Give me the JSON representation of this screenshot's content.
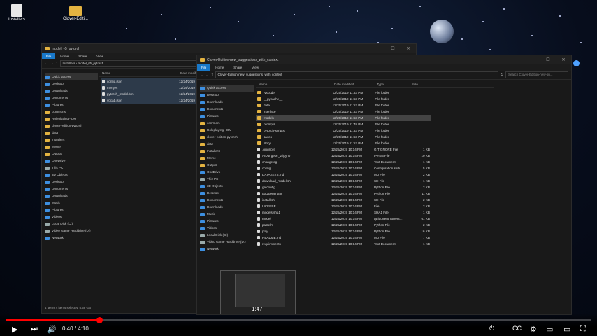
{
  "desktop": {
    "icons": [
      {
        "label": "Installers",
        "icon": "installer-icon"
      },
      {
        "label": "Clover-Editi...",
        "icon": "folder-icon"
      }
    ]
  },
  "back_window": {
    "title": "model_v5_pytorch",
    "ribbon": [
      "File",
      "Home",
      "Share",
      "View"
    ],
    "path": [
      "Installers",
      "model_v5_pytorch"
    ],
    "nav": {
      "quick_access": "Quick access",
      "pinned": [
        "Desktop",
        "Downloads",
        "Documents",
        "Pictures",
        "commons",
        "Roleplaying - DM",
        "clover-edition-pytorch",
        "data",
        "Installers",
        "Meme",
        "Output"
      ],
      "onedrive": "OneDrive",
      "this_pc": "This PC",
      "pc_items": [
        "3D Objects",
        "Desktop",
        "Documents",
        "Downloads",
        "Music",
        "Pictures",
        "Videos",
        "Local Disk (C:)",
        "Video Game Harddrive (D:)"
      ],
      "network": "Network"
    },
    "columns": {
      "name": "Name",
      "date": "Date modifi"
    },
    "files": [
      {
        "name": "config.json",
        "date": "12/24/2019"
      },
      {
        "name": "merges",
        "date": "12/24/2019"
      },
      {
        "name": "pytorch_model.bin",
        "date": "12/24/2019"
      },
      {
        "name": "vocab.json",
        "date": "12/24/2019"
      }
    ],
    "status": "4 items    4 items selected  5.59 GB"
  },
  "front_window": {
    "title": "Clover-Edition-new_suggestions_with_context",
    "ribbon": [
      "File",
      "Home",
      "Share",
      "View"
    ],
    "path": [
      "Clover-Edition-new_suggestions_with_context"
    ],
    "search_placeholder": "Search Clover-Edition-new-su...",
    "nav": {
      "quick_access": "Quick access",
      "pinned": [
        "Desktop",
        "Downloads",
        "Documents",
        "Pictures",
        "common",
        "Roleplaying - DM",
        "clover-edition-pytorch",
        "data",
        "Installers",
        "Meme",
        "Output"
      ],
      "onedrive": "OneDrive",
      "this_pc": "This PC",
      "pc_items": [
        "3D Objects",
        "Desktop",
        "Documents",
        "Downloads",
        "Music",
        "Pictures",
        "Videos",
        "Local Disk (C:)",
        "Video Game Harddrive (D:)"
      ],
      "network": "Network"
    },
    "columns": {
      "name": "Name",
      "date": "Date modified",
      "type": "Type",
      "size": "Size"
    },
    "files": [
      {
        "name": ".vscode",
        "date": "12/25/2019 11:53 PM",
        "type": "File folder",
        "size": "",
        "kind": "folder"
      },
      {
        "name": "__pycache__",
        "date": "12/25/2019 11:53 PM",
        "type": "File folder",
        "size": "",
        "kind": "folder"
      },
      {
        "name": "data",
        "date": "12/25/2019 11:53 PM",
        "type": "File folder",
        "size": "",
        "kind": "folder"
      },
      {
        "name": "interface",
        "date": "12/25/2019 11:53 PM",
        "type": "File folder",
        "size": "",
        "kind": "folder"
      },
      {
        "name": "models",
        "date": "12/25/2019 11:53 PM",
        "type": "File folder",
        "size": "",
        "kind": "folder"
      },
      {
        "name": "prompts",
        "date": "12/25/2019 11:48 PM",
        "type": "File folder",
        "size": "",
        "kind": "folder"
      },
      {
        "name": "pytorch-scripts",
        "date": "12/25/2019 11:53 PM",
        "type": "File folder",
        "size": "",
        "kind": "folder"
      },
      {
        "name": "saves",
        "date": "12/25/2019 11:53 PM",
        "type": "File folder",
        "size": "",
        "kind": "folder"
      },
      {
        "name": "story",
        "date": "12/25/2019 11:53 PM",
        "type": "File folder",
        "size": "",
        "kind": "folder"
      },
      {
        "name": ".gitignore",
        "date": "12/25/2019 10:14 PM",
        "type": "GITIGNORE File",
        "size": "1 KB",
        "kind": "file"
      },
      {
        "name": "AIDungeon_2.ipynb",
        "date": "12/25/2019 10:14 PM",
        "type": "IPYNB File",
        "size": "10 KB",
        "kind": "file"
      },
      {
        "name": "changelog",
        "date": "12/25/2019 10:14 PM",
        "type": "Text Document",
        "size": "1 KB",
        "kind": "file"
      },
      {
        "name": "config",
        "date": "12/25/2019 10:14 PM",
        "type": "Configuration setti...",
        "size": "5 KB",
        "kind": "file"
      },
      {
        "name": "DATASETS.md",
        "date": "12/25/2019 10:14 PM",
        "type": "MD File",
        "size": "2 KB",
        "kind": "file"
      },
      {
        "name": "download_model.sh",
        "date": "12/25/2019 10:14 PM",
        "type": "SH File",
        "size": "1 KB",
        "kind": "file"
      },
      {
        "name": "getconfig",
        "date": "12/25/2019 10:14 PM",
        "type": "Python File",
        "size": "2 KB",
        "kind": "file"
      },
      {
        "name": "gpt2generator",
        "date": "12/25/2019 10:14 PM",
        "type": "Python File",
        "size": "11 KB",
        "kind": "file"
      },
      {
        "name": "install.sh",
        "date": "12/25/2019 10:14 PM",
        "type": "SH File",
        "size": "2 KB",
        "kind": "file"
      },
      {
        "name": "LICENSE",
        "date": "12/25/2019 10:14 PM",
        "type": "File",
        "size": "2 KB",
        "kind": "file"
      },
      {
        "name": "models.sha1",
        "date": "12/25/2019 10:14 PM",
        "type": "SHA1 File",
        "size": "1 KB",
        "kind": "file"
      },
      {
        "name": "model",
        "date": "12/25/2019 10:14 PM",
        "type": "qBittorrent Torrent...",
        "size": "61 KB",
        "kind": "file"
      },
      {
        "name": "pastelm",
        "date": "12/25/2019 10:14 PM",
        "type": "Python File",
        "size": "2 KB",
        "kind": "file"
      },
      {
        "name": "play",
        "date": "12/25/2019 10:14 PM",
        "type": "Python File",
        "size": "16 KB",
        "kind": "file"
      },
      {
        "name": "README.md",
        "date": "12/25/2019 10:14 PM",
        "type": "MD File",
        "size": "7 KB",
        "kind": "file"
      },
      {
        "name": "requirements",
        "date": "12/25/2019 10:14 PM",
        "type": "Text Document",
        "size": "1 KB",
        "kind": "file"
      }
    ]
  },
  "player": {
    "time": "0:40 / 4:10",
    "progress_fraction": 0.16,
    "preview_time": "1:47"
  }
}
